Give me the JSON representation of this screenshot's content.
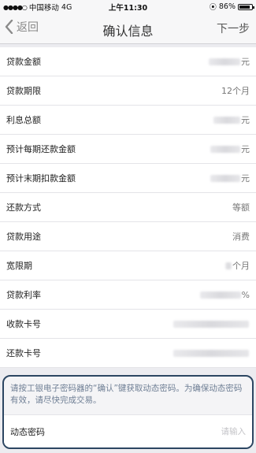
{
  "status_bar": {
    "carrier": "中国移动",
    "network": "4G",
    "time": "上午11:30",
    "battery": "86%",
    "battery_level": 0.86
  },
  "nav": {
    "back_label": "返回",
    "title": "确认信息",
    "next_label": "下一步"
  },
  "rows": [
    {
      "label": "贷款金额",
      "value_suffix": "元"
    },
    {
      "label": "贷款期限",
      "value_suffix": "12个月"
    },
    {
      "label": "利息总额",
      "value_suffix": "元"
    },
    {
      "label": "预计每期还款金额",
      "value_suffix": "元"
    },
    {
      "label": "预计末期扣款金额",
      "value_suffix": "元"
    },
    {
      "label": "还款方式",
      "value_suffix": "等额"
    },
    {
      "label": "贷款用途",
      "value_suffix": "消费"
    },
    {
      "label": "宽限期",
      "value_suffix": "个月"
    },
    {
      "label": "贷款利率",
      "value_suffix": "%"
    },
    {
      "label": "收款卡号",
      "value_suffix": ""
    },
    {
      "label": "还款卡号",
      "value_suffix": ""
    }
  ],
  "notice": {
    "text": "请按工银电子密码器的“确认”键获取动态密码。为确保动态密码有效，请尽快完成交易。"
  },
  "otp": {
    "label": "动态密码",
    "placeholder": "请输入"
  }
}
